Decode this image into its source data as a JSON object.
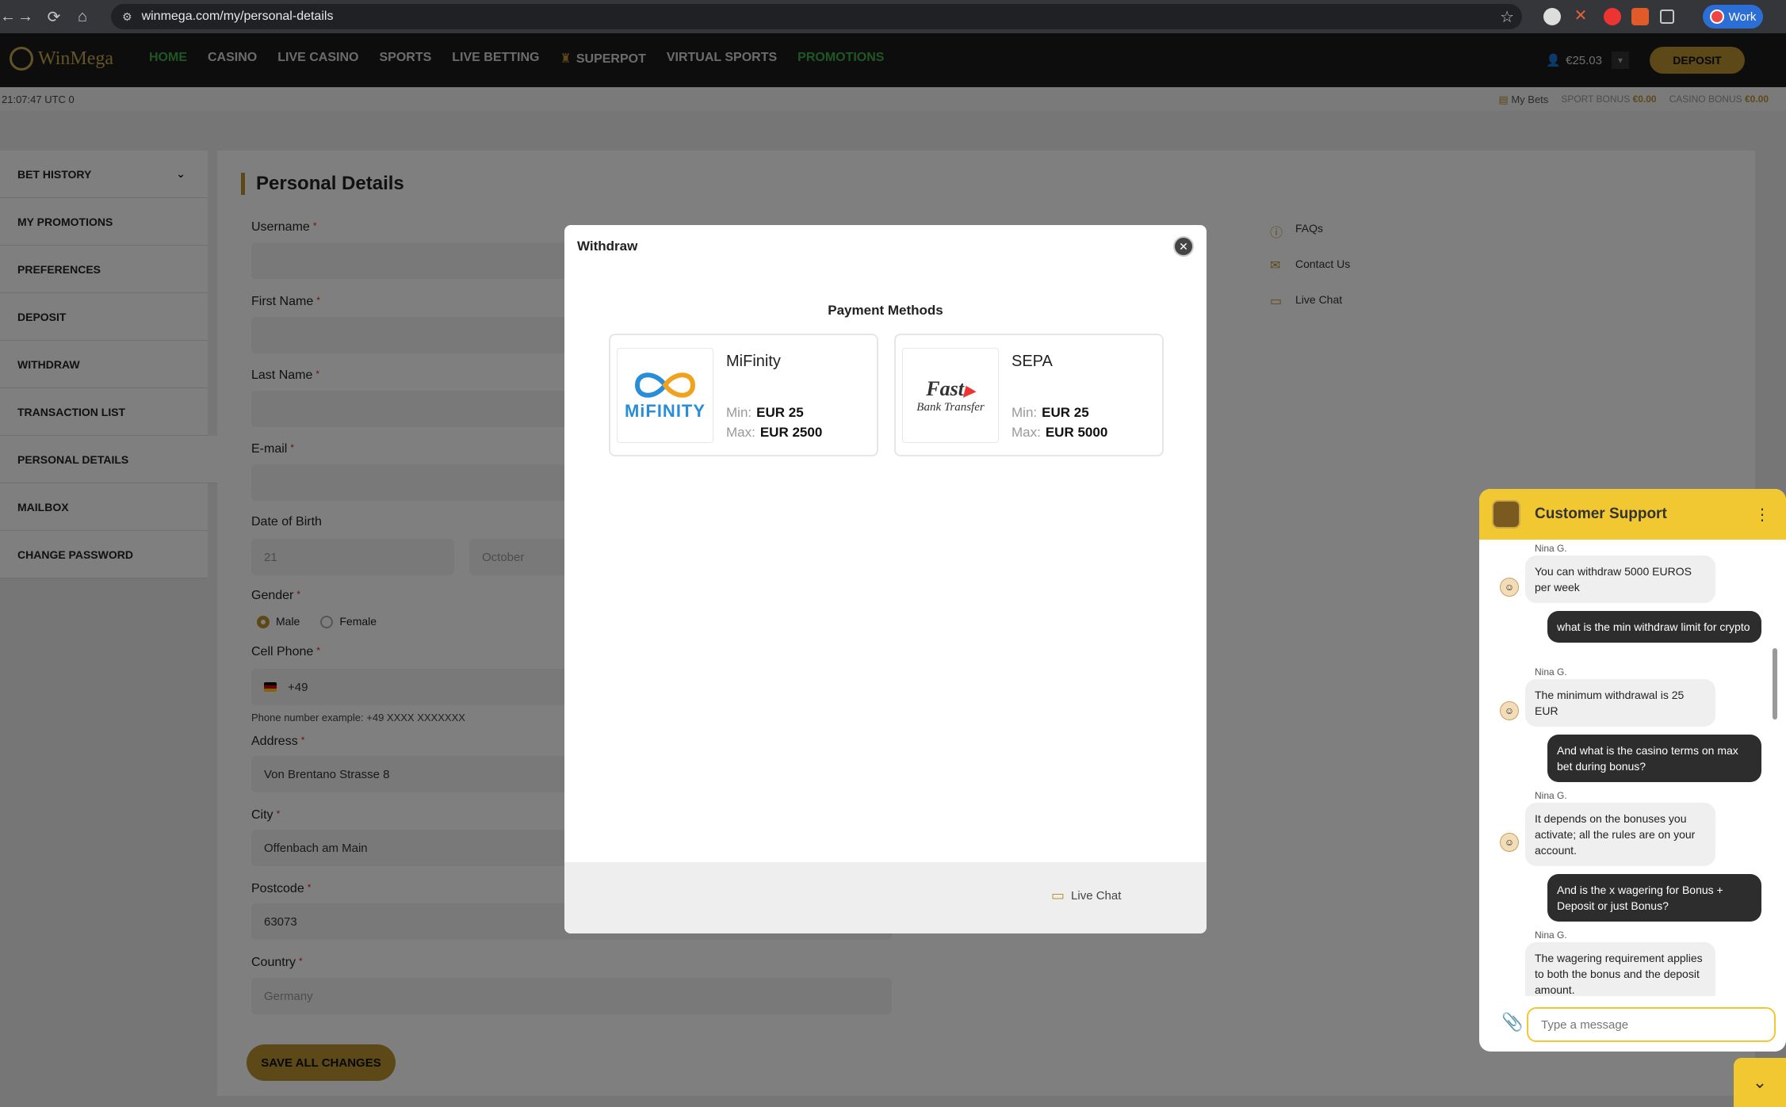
{
  "browser": {
    "url": "winmega.com/my/personal-details",
    "profile_label": "Work"
  },
  "site": {
    "logo_text": "WinMega",
    "nav": [
      "HOME",
      "CASINO",
      "LIVE CASINO",
      "SPORTS",
      "LIVE BETTING",
      "SUPERPOT",
      "VIRTUAL SPORTS",
      "PROMOTIONS"
    ],
    "balance": "€25.03",
    "deposit_label": "DEPOSIT",
    "clock": "21:07:47 UTC 0",
    "my_bets": "My Bets",
    "sport_bonus_label": "SPORT BONUS",
    "sport_bonus_value": "€0.00",
    "casino_bonus_label": "CASINO BONUS",
    "casino_bonus_value": "€0.00"
  },
  "sidebar": {
    "items": [
      "BET HISTORY",
      "MY PROMOTIONS",
      "PREFERENCES",
      "DEPOSIT",
      "WITHDRAW",
      "TRANSACTION LIST",
      "PERSONAL DETAILS",
      "MAILBOX",
      "CHANGE PASSWORD"
    ]
  },
  "form": {
    "title": "Personal Details",
    "username_label": "Username",
    "first_name_label": "First Name",
    "last_name_label": "Last Name",
    "email_label": "E-mail",
    "dob_label": "Date of Birth",
    "dob_day": "21",
    "dob_month": "October",
    "gender_label": "Gender",
    "gender_male": "Male",
    "gender_female": "Female",
    "phone_label": "Cell Phone",
    "phone_code": "+49",
    "phone_hint": "Phone number example: +49 XXXX XXXXXXX",
    "address_label": "Address",
    "address_value": "Von Brentano Strasse 8",
    "city_label": "City",
    "city_value": "Offenbach am Main",
    "postcode_label": "Postcode",
    "postcode_value": "63073",
    "country_label": "Country",
    "country_value": "Germany",
    "save_label": "SAVE ALL CHANGES"
  },
  "help": {
    "faqs": "FAQs",
    "contact": "Contact Us",
    "live_chat": "Live Chat"
  },
  "modal": {
    "title": "Withdraw",
    "section_title": "Payment Methods",
    "methods": [
      {
        "name": "MiFinity",
        "logo_text": "MiFINITY",
        "min_label": "Min:",
        "min": "EUR 25",
        "max_label": "Max:",
        "max": "EUR 2500"
      },
      {
        "name": "SEPA",
        "logo_text": "Fast",
        "logo_sub": "Bank Transfer",
        "min_label": "Min:",
        "min": "EUR 25",
        "max_label": "Max:",
        "max": "EUR 5000"
      }
    ],
    "footer_chat": "Live Chat"
  },
  "chat": {
    "title": "Customer Support",
    "messages": [
      {
        "from": "agent",
        "name": "Nina G.",
        "text": "You can withdraw 5000 EUROS per week"
      },
      {
        "from": "user",
        "text": "what is the min withdraw limit for crypto"
      },
      {
        "from": "agent",
        "name": "Nina G.",
        "text": "The minimum withdrawal is 25 EUR"
      },
      {
        "from": "user",
        "text": "And what is the casino terms on max bet during bonus?"
      },
      {
        "from": "agent",
        "name": "Nina G.",
        "text": "It depends on the bonuses you activate; all the rules are on your account."
      },
      {
        "from": "user",
        "text": "And is the x wagering for Bonus + Deposit or just Bonus?"
      },
      {
        "from": "agent",
        "name": "Nina G.",
        "text": "The wagering requirement applies to both the bonus and the deposit amount."
      }
    ],
    "input_placeholder": "Type a message"
  },
  "colors": {
    "gold": "#b8922f",
    "nav_active": "#3fae49",
    "chat_yellow": "#f2c832"
  }
}
